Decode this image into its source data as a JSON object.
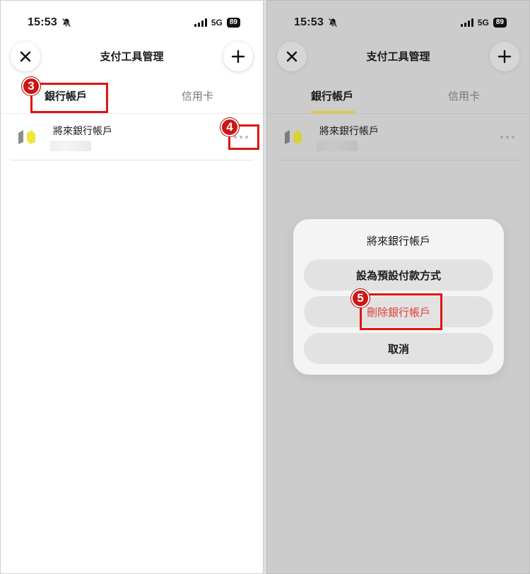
{
  "status_bar": {
    "time": "15:53",
    "network": "5G",
    "battery": "89"
  },
  "header": {
    "title": "支付工具管理"
  },
  "tabs": [
    {
      "label": "銀行帳戶",
      "active": true
    },
    {
      "label": "信用卡",
      "active": false
    }
  ],
  "account": {
    "name": "將來銀行帳戶"
  },
  "action_sheet": {
    "title": "將來銀行帳戶",
    "buttons": [
      {
        "label": "設為預設付款方式"
      },
      {
        "label": "刪除銀行帳戶",
        "color": "#e0403a"
      },
      {
        "label": "取消"
      }
    ]
  },
  "annotations": {
    "step3": "3",
    "step4": "4",
    "step5": "5"
  },
  "colors": {
    "highlight": "#e0140f",
    "tab_underline": "#e6c830",
    "logo_yellow": "#f1e63c",
    "logo_gray": "#8d8d8d"
  },
  "icons": [
    "bell-muted-icon",
    "signal-icon",
    "close-icon",
    "plus-icon",
    "bank-logo-icon",
    "more-dots-icon"
  ]
}
